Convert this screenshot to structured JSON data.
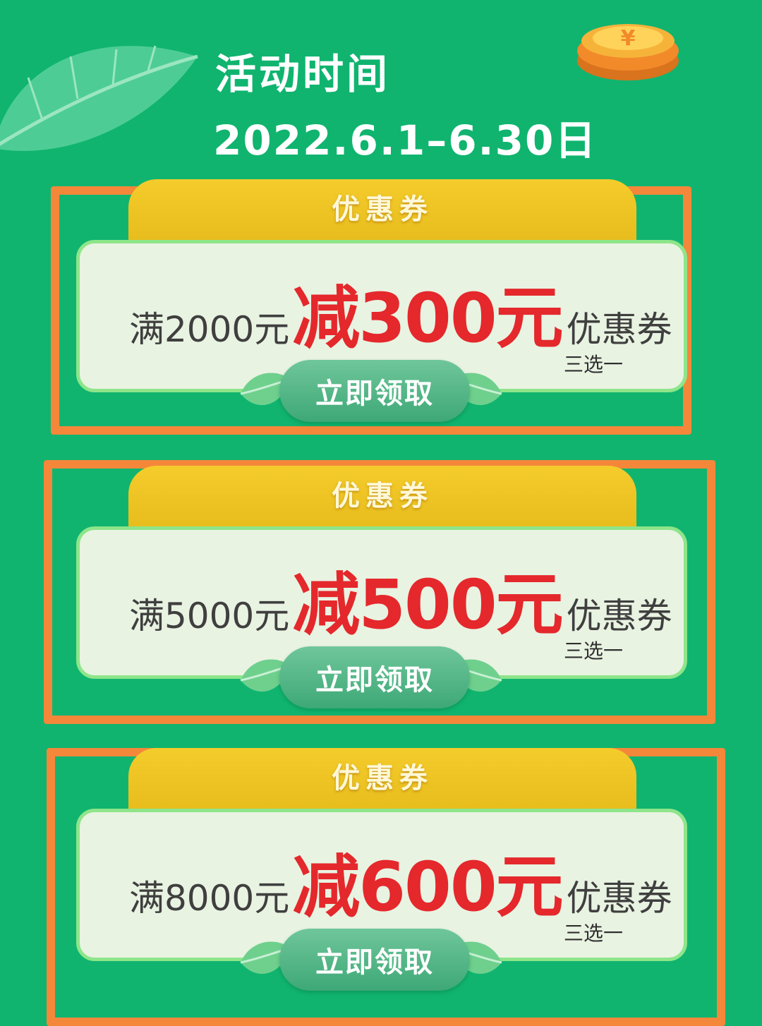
{
  "event": {
    "title": "活动时间",
    "dates": "2022.6.1–6.30日"
  },
  "coupons": [
    {
      "tab_label": "优惠券",
      "prefix": "满2000元",
      "discount": "减300元",
      "suffix": "优惠券",
      "note": "三选一",
      "claim_label": "立即领取"
    },
    {
      "tab_label": "优惠券",
      "prefix": "满5000元",
      "discount": "减500元",
      "suffix": "优惠券",
      "note": "三选一",
      "claim_label": "立即领取"
    },
    {
      "tab_label": "优惠券",
      "prefix": "满8000元",
      "discount": "减600元",
      "suffix": "优惠券",
      "note": "三选一",
      "claim_label": "立即领取"
    }
  ],
  "colors": {
    "background": "#10b46f",
    "highlight_frame": "#f4873a",
    "tab": "#f4cc2b",
    "card": "#e9f3e2",
    "discount_text": "#e4282c",
    "claim_button": "#4fb583"
  },
  "icons": [
    "leaf-icon",
    "coin-stack-icon"
  ]
}
